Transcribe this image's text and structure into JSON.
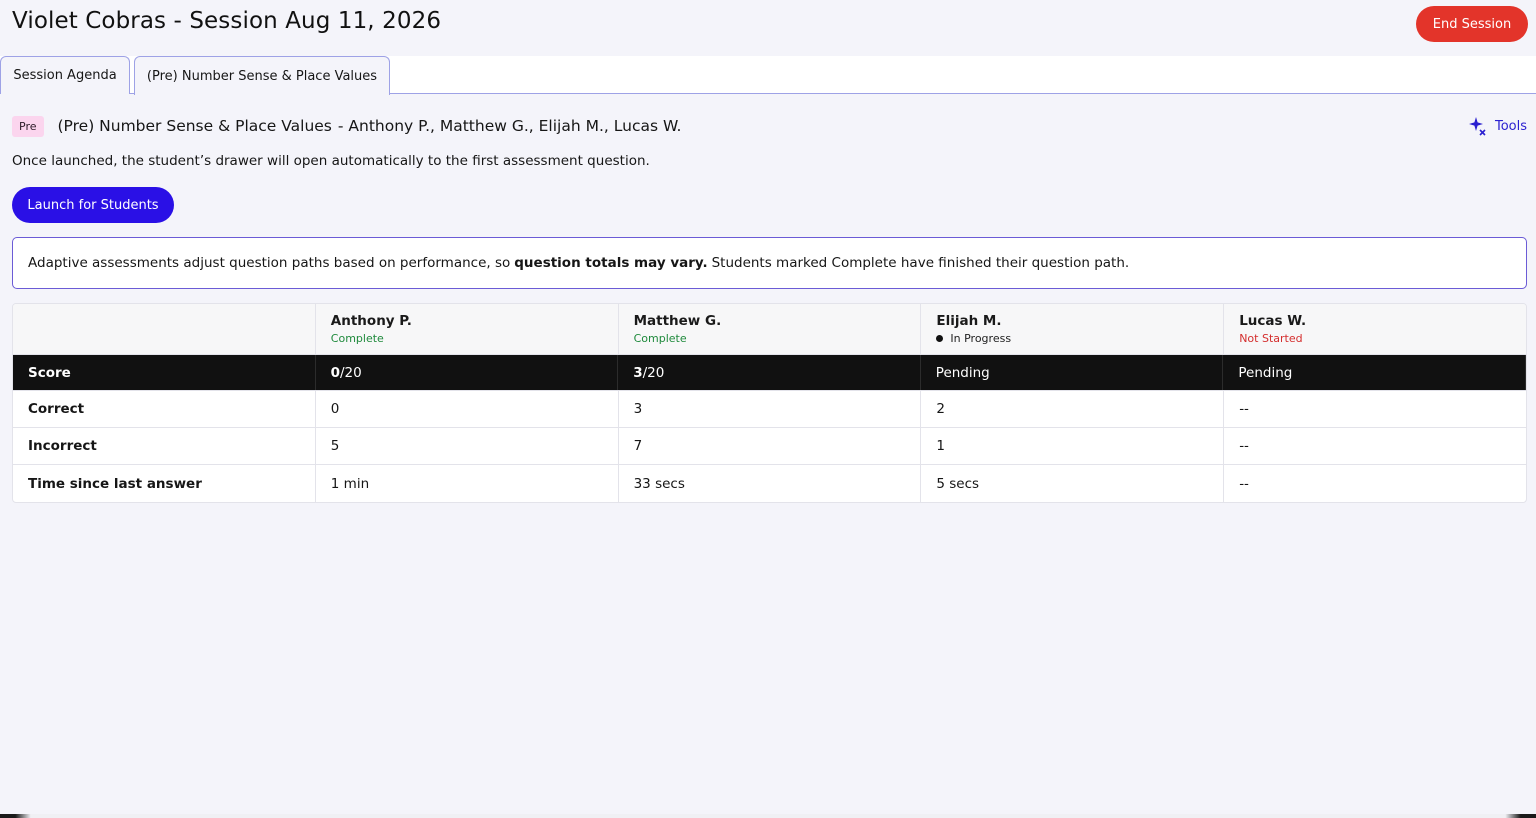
{
  "header": {
    "title": "Violet Cobras - Session Aug 11, 2026",
    "end_session_label": "End Session"
  },
  "tabs": [
    {
      "label": "Session Agenda",
      "active": false
    },
    {
      "label": "(Pre) Number Sense & Place Values",
      "active": true
    }
  ],
  "assessment": {
    "badge": "Pre",
    "title": "(Pre) Number Sense & Place Values",
    "students_line": "- Anthony P., Matthew G., Elijah M., Lucas W.",
    "tools_label": "Tools",
    "tools_icon": "sparkles-icon",
    "info_text": "Once launched, the student’s drawer will open automatically to the first assessment question.",
    "launch_label": "Launch for Students"
  },
  "notice": {
    "prefix": "Adaptive assessments adjust question paths based on performance, so",
    "bold": "question totals may vary.",
    "suffix": "Students marked Complete have finished their question path."
  },
  "table": {
    "students": [
      {
        "name": "Anthony P.",
        "status": "Complete",
        "status_type": "complete"
      },
      {
        "name": "Matthew G.",
        "status": "Complete",
        "status_type": "complete"
      },
      {
        "name": "Elijah M.",
        "status": "In Progress",
        "status_type": "progress"
      },
      {
        "name": "Lucas W.",
        "status": "Not Started",
        "status_type": "notstarted"
      }
    ],
    "score_row": {
      "label": "Score",
      "values": [
        {
          "num": "0",
          "total": "/20"
        },
        {
          "num": "3",
          "total": "/20"
        },
        {
          "num": "",
          "total": "Pending"
        },
        {
          "num": "",
          "total": "Pending"
        }
      ]
    },
    "rows": [
      {
        "label": "Correct",
        "values": [
          "0",
          "3",
          "2",
          "--"
        ]
      },
      {
        "label": "Incorrect",
        "values": [
          "5",
          "7",
          "1",
          "--"
        ]
      },
      {
        "label": "Time since last answer",
        "values": [
          "1 min",
          "33 secs",
          "5 secs",
          "--"
        ]
      }
    ]
  },
  "colors": {
    "end_session": "#e3342a",
    "launch": "#2a10e6",
    "complete": "#1f8a3c",
    "not_started": "#d42e2e",
    "accent_border": "#6b5bd6"
  }
}
